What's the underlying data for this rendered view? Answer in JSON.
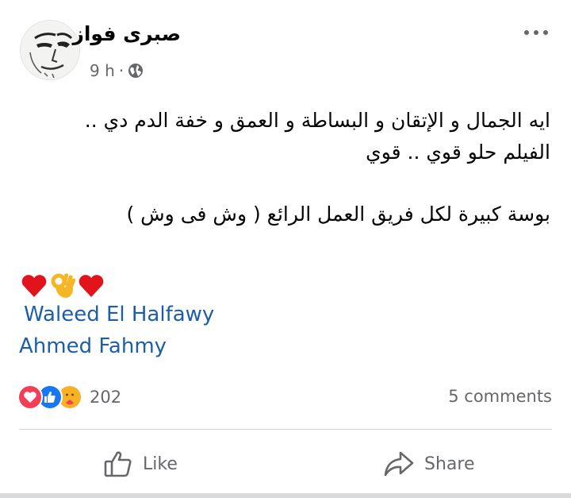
{
  "post": {
    "author": "صبرى فواز",
    "time": "9 h",
    "separator": "·",
    "body_lines": [
      "ايه الجمال و الإتقان و البساطة و العمق و خفة الدم دي ..",
      "الفيلم حلو قوي .. قوي",
      "بوسة كبيرة لكل فريق العمل الرائع ( وش فى وش )"
    ],
    "emoji_row": [
      "red-heart",
      "ok-hand",
      "red-heart"
    ],
    "mentions": [
      "Waleed El Halfawy",
      "Ahmed Fahmy"
    ]
  },
  "stats": {
    "reactions": [
      "love",
      "like",
      "care"
    ],
    "reaction_count": "202",
    "comments": "5 comments"
  },
  "actions": {
    "like_label": "Like",
    "share_label": "Share"
  },
  "colors": {
    "mention": "#1c5fa8",
    "meta_gray": "#65676b",
    "love_red": "#f33e58",
    "like_blue": "#1877f2"
  }
}
